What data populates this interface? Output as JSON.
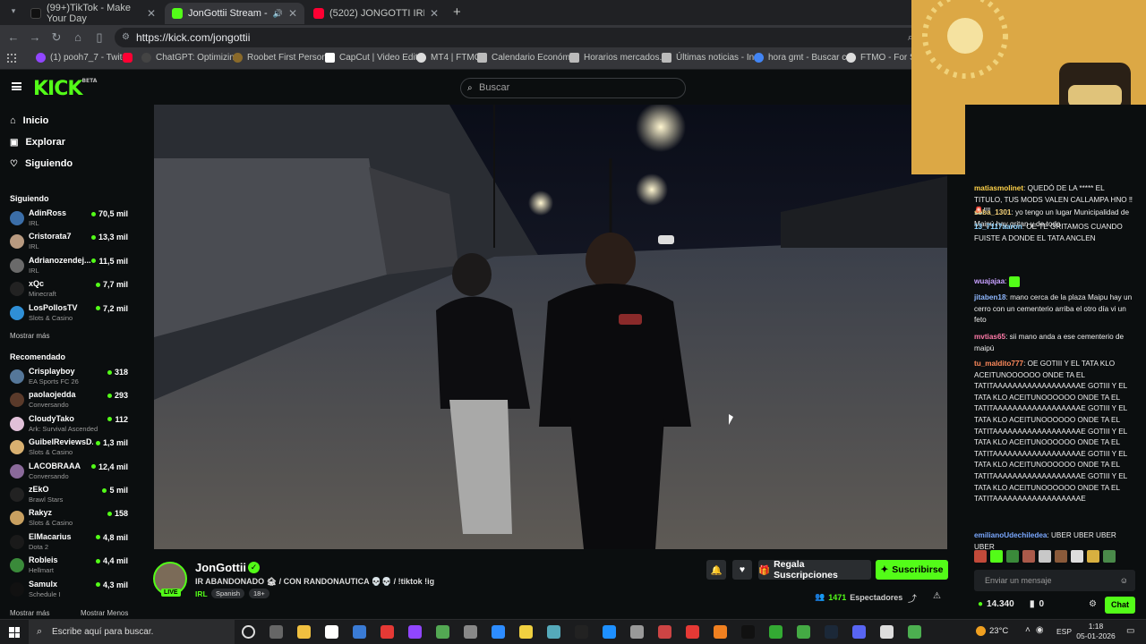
{
  "browser": {
    "tabs": [
      {
        "title": "(99+)TikTok - Make Your Day",
        "color": "#111111"
      },
      {
        "title": "JonGottii Stream - Watch L",
        "color": "#53fc18"
      },
      {
        "title": "(5202) JONGOTTI IRL CEMENT",
        "color": "#ff0033"
      }
    ],
    "url": "https://kick.com/jongottii",
    "bookmarks": [
      {
        "label": "(1) pooh7_7 - Twitch",
        "color": "#9146ff"
      },
      {
        "label": "",
        "color": "#ff0033"
      },
      {
        "label": "ChatGPT: Optimizin...",
        "color": "#444444"
      },
      {
        "label": "Roobet First Person...",
        "color": "#8a6a2a"
      },
      {
        "label": "CapCut | Video Edit...",
        "color": "#ffffff"
      },
      {
        "label": "MT4 | FTMO",
        "color": "#dddddd"
      },
      {
        "label": "Calendario Económ...",
        "color": "#bbbbbb"
      },
      {
        "label": "Horarios mercados...",
        "color": "#bbbbbb"
      },
      {
        "label": "Últimas noticias - In...",
        "color": "#bbbbbb"
      },
      {
        "label": "hora gmt - Buscar c...",
        "color": "#4285f4"
      },
      {
        "label": "FTMO - For Serio...",
        "color": "#dddddd"
      }
    ]
  },
  "header": {
    "logo": "KICK",
    "beta": "BETA",
    "search_placeholder": "Buscar"
  },
  "sidebar": {
    "nav": [
      {
        "label": "Inicio",
        "icon": "home-icon"
      },
      {
        "label": "Explorar",
        "icon": "compass-icon"
      },
      {
        "label": "Siguiendo",
        "icon": "heart-icon"
      }
    ],
    "following_title": "Siguiendo",
    "following": [
      {
        "name": "AdinRoss",
        "category": "IRL",
        "viewers": "70,5 mil",
        "color": "#3b6ea8"
      },
      {
        "name": "Cristorata7",
        "category": "IRL",
        "viewers": "13,3 mil",
        "color": "#b89a80"
      },
      {
        "name": "Adrianozendej...",
        "category": "IRL",
        "viewers": "11,5 mil",
        "color": "#6a6a6a"
      },
      {
        "name": "xQc",
        "category": "Minecraft",
        "viewers": "7,7 mil",
        "color": "#222222"
      },
      {
        "name": "LosPollosTV",
        "category": "Slots & Casino",
        "viewers": "7,2 mil",
        "color": "#2f8fd6"
      }
    ],
    "show_more": "Mostrar más",
    "recommended_title": "Recomendado",
    "recommended": [
      {
        "name": "Crisplayboy",
        "category": "EA Sports FC 26",
        "viewers": "318",
        "color": "#557799"
      },
      {
        "name": "paolaojedda",
        "category": "Conversando",
        "viewers": "293",
        "color": "#5a3a2a"
      },
      {
        "name": "CloudyTako",
        "category": "Ark: Survival Ascended",
        "viewers": "112",
        "color": "#e0c0d8"
      },
      {
        "name": "GuibelReviewsD...",
        "category": "Slots & Casino",
        "viewers": "1,3 mil",
        "color": "#d8b070"
      },
      {
        "name": "LACOBRAAA",
        "category": "Conversando",
        "viewers": "12,4 mil",
        "color": "#8a6a9a"
      },
      {
        "name": "zEkO",
        "category": "Brawl Stars",
        "viewers": "5 mil",
        "color": "#222222"
      },
      {
        "name": "Rakyz",
        "category": "Slots & Casino",
        "viewers": "158",
        "color": "#c8a060"
      },
      {
        "name": "ElMacarius",
        "category": "Dota 2",
        "viewers": "4,8 mil",
        "color": "#1a1a1a"
      },
      {
        "name": "Robleis",
        "category": "Hellmart",
        "viewers": "4,4 mil",
        "color": "#3a8a3a"
      },
      {
        "name": "Samulx",
        "category": "Schedule I",
        "viewers": "4,3 mil",
        "color": "#111111"
      }
    ],
    "show_more_bottom": "Mostrar más",
    "show_less": "Mostrar Menos"
  },
  "stream": {
    "channel": "JonGottii",
    "live": "LIVE",
    "title": "IR ABANDONADO 🏚 / CON RANDONAUTICA 💀💀 / !tiktok !ig",
    "tags": [
      "IRL",
      "Spanish",
      "18+"
    ],
    "gift_label": "Regala Suscripciones",
    "subscribe_label": "Suscribirse",
    "viewers": "1471",
    "viewers_label": "Espectadores"
  },
  "chat": {
    "messages": [
      {
        "user": "matiasmolinet",
        "color": "#ffd24a",
        "text": "QUEDÓ DE LA ***** EL TITULO, TUS MODS VALEN CALLAMPA HNO ‼ 🚨‼‼"
      },
      {
        "user": "seba_1301",
        "color": "#f5d27a",
        "text": "yo tengo un lugar Municipalidad de Maipú hay gritan y de todo"
      },
      {
        "user": "13_7117aaron",
        "color": "#8fd3ff",
        "text": "OE TE GRITAMOS CUANDO FUISTE A DONDE EL TATA ANCLEN"
      },
      {
        "user": "wuajajaa",
        "color": "#c7a0ff",
        "text": ""
      },
      {
        "user": "jitaben18",
        "color": "#8fb8ff",
        "text": "mano cerca de la plaza Maipu hay un cerro con un cementerio arriba el otro día vi un feto"
      },
      {
        "user": "mvtias65",
        "color": "#ff7aa8",
        "text": "sii mano anda a ese cementerio de maipú"
      },
      {
        "user": "tu_maldito777",
        "color": "#ff8a5c",
        "text": "OE GOTIII Y EL TATA KLO ACEITUNOOOOOO ONDE TA EL TATITAAAAAAAAAAAAAAAAAAE GOTIII Y EL TATA KLO ACEITUNOOOOOO ONDE TA EL TATITAAAAAAAAAAAAAAAAAAE GOTIII Y EL TATA KLO ACEITUNOOOOOO ONDE TA EL TATITAAAAAAAAAAAAAAAAAAE GOTIII Y EL TATA KLO ACEITUNOOOOOO ONDE TA EL TATITAAAAAAAAAAAAAAAAAAE GOTIII Y EL TATA KLO ACEITUNOOOOOO ONDE TA EL TATITAAAAAAAAAAAAAAAAAAE GOTIII Y EL TATA KLO ACEITUNOOOOOO ONDE TA EL TATITAAAAAAAAAAAAAAAAAAE"
      },
      {
        "user": "emilianoUdechiledea",
        "color": "#7aa8ff",
        "text": "UBER UBER UBER UBER"
      }
    ],
    "input_placeholder": "Enviar un mensaje",
    "points": "14.340",
    "zero": "0",
    "chat_button": "Chat"
  },
  "taskbar": {
    "search_placeholder": "Escribe aquí para buscar.",
    "temperature": "23°C",
    "language": "ESP",
    "time": "1:18",
    "date": "05-01-2026"
  }
}
